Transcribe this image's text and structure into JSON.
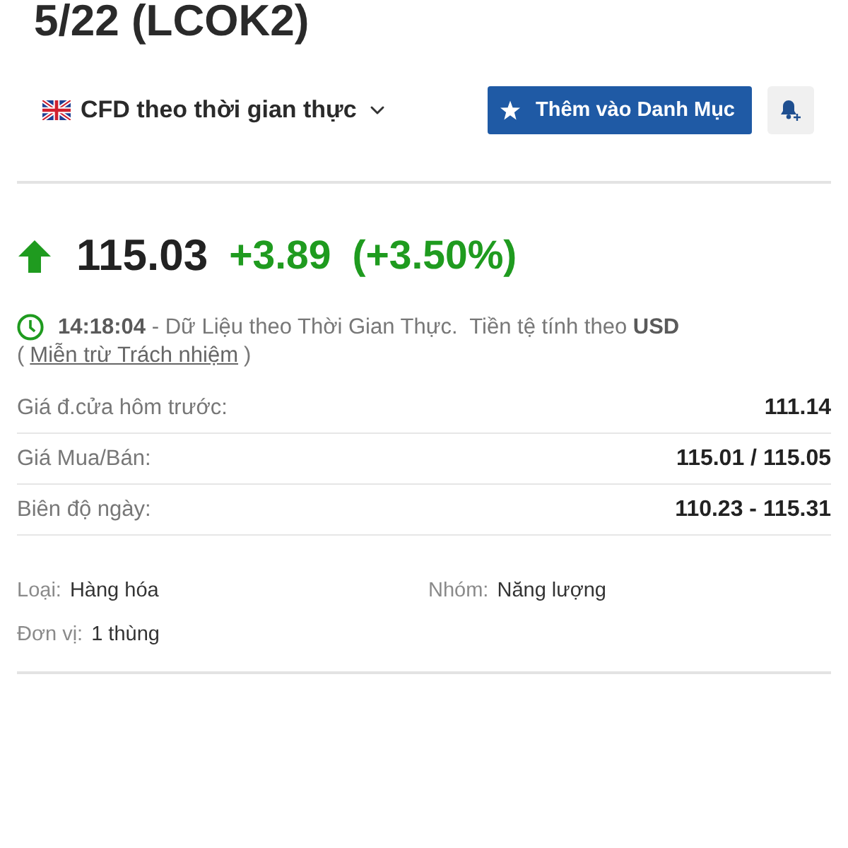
{
  "header": {
    "title": "5/22 (LCOK2)"
  },
  "toolbar": {
    "data_source": {
      "label": "CFD theo thời gian thực"
    },
    "watchlist_button": {
      "label": "Thêm vào Danh Mục"
    }
  },
  "quote": {
    "rising": true,
    "last": "115.03",
    "change": "+3.89",
    "change_percent": "(+3.50%)"
  },
  "timestamp": {
    "text": "**14:18:04** - Dữ Liệu theo Thời Gian Thực.  Tiền tệ tính theo **USD**"
  },
  "disclaimer": {
    "open": "(",
    "link": "Miễn trừ Trách nhiệm",
    "close": ")"
  },
  "stats": [
    {
      "label": "Giá đ.cửa hôm trước:",
      "value": "111.14"
    },
    {
      "label": "Giá Mua/Bán:",
      "value": "115.01 / 115.05"
    },
    {
      "label": "Biên độ ngày:",
      "value": "110.23 - 115.31"
    }
  ],
  "details": [
    {
      "label": "Loại:",
      "value": "Hàng hóa"
    },
    {
      "label": "Nhóm:",
      "value": "Năng lượng"
    },
    {
      "label": "Đơn vị:",
      "value": "1 thùng"
    }
  ]
}
